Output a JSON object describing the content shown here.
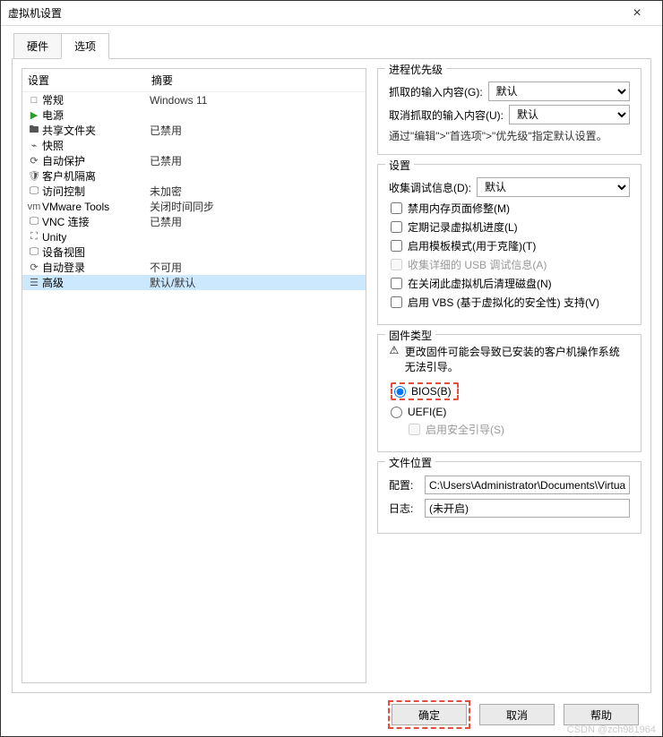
{
  "window": {
    "title": "虚拟机设置"
  },
  "tabs": {
    "t0": "硬件",
    "t1": "选项"
  },
  "list": {
    "h0": "设置",
    "h1": "摘要",
    "items": [
      {
        "ico": "□",
        "name": "常规",
        "sum": "Windows 11"
      },
      {
        "ico": "▶",
        "name": "电源",
        "sum": "",
        "green": true
      },
      {
        "ico": "🖿",
        "name": "共享文件夹",
        "sum": "已禁用"
      },
      {
        "ico": "⌁",
        "name": "快照",
        "sum": ""
      },
      {
        "ico": "⟳",
        "name": "自动保护",
        "sum": "已禁用"
      },
      {
        "ico": "🛡",
        "name": "客户机隔离",
        "sum": ""
      },
      {
        "ico": "🖵",
        "name": "访问控制",
        "sum": "未加密"
      },
      {
        "ico": "vm",
        "name": "VMware Tools",
        "sum": "关闭时间同步"
      },
      {
        "ico": "🖵",
        "name": "VNC 连接",
        "sum": "已禁用"
      },
      {
        "ico": "⛶",
        "name": "Unity",
        "sum": ""
      },
      {
        "ico": "🖵",
        "name": "设备视图",
        "sum": ""
      },
      {
        "ico": "⟳",
        "name": "自动登录",
        "sum": "不可用"
      },
      {
        "ico": "☰",
        "name": "高级",
        "sum": "默认/默认",
        "sel": true
      }
    ]
  },
  "prio": {
    "title": "进程优先级",
    "grab_lbl": "抓取的输入内容(G):",
    "ungrab_lbl": "取消抓取的输入内容(U):",
    "defval": "默认",
    "note": "通过\"编辑\">\"首选项\">\"优先级\"指定默认设置。"
  },
  "settings": {
    "title": "设置",
    "dbg_lbl": "收集调试信息(D):",
    "dbg_val": "默认",
    "c0": "禁用内存页面修整(M)",
    "c1": "定期记录虚拟机进度(L)",
    "c2": "启用模板模式(用于克隆)(T)",
    "c3": "收集详细的 USB 调试信息(A)",
    "c4": "在关闭此虚拟机后清理磁盘(N)",
    "c5": "启用 VBS (基于虚拟化的安全性) 支持(V)"
  },
  "fw": {
    "title": "固件类型",
    "warn": "更改固件可能会导致已安装的客户机操作系统无法引导。",
    "bios": "BIOS(B)",
    "uefi": "UEFI(E)",
    "secure": "启用安全引导(S)"
  },
  "loc": {
    "title": "文件位置",
    "cfg_lbl": "配置:",
    "cfg_val": "C:\\Users\\Administrator\\Documents\\Virtual Ma",
    "log_lbl": "日志:",
    "log_val": "(未开启)"
  },
  "btn": {
    "ok": "确定",
    "cancel": "取消",
    "help": "帮助"
  },
  "watermark": "CSDN @zch981964"
}
